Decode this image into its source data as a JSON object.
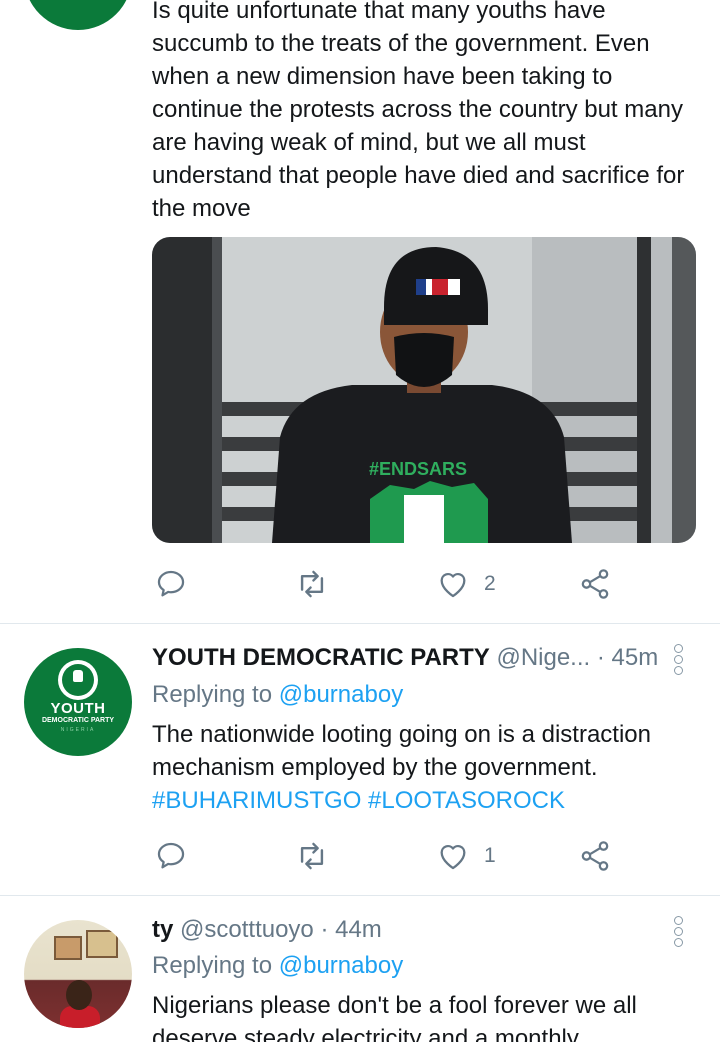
{
  "tweets": [
    {
      "text": "Is quite unfortunate that many youths have succumb to the treats of the government. Even when a new dimension have been taking to continue the protests across the country but many are having weak of mind, but we all must understand that people have died and sacrifice for the move",
      "media": {
        "shirt_text": "#ENDSARS"
      },
      "actions": {
        "reply_count": "",
        "retweet_count": "",
        "like_count": "2"
      }
    },
    {
      "display_name": "YOUTH DEMOCRATIC PARTY",
      "handle": "@Nige...",
      "time": "· 45m",
      "replying_prefix": "Replying to",
      "replying_to": "@burnaboy",
      "text": "The nationwide looting going on is a distraction mechanism employed by the government.",
      "hashtags": [
        "#BUHARIMUSTGO",
        "#LOOTASOROCK"
      ],
      "avatar": {
        "big": "YOUTH",
        "sub": "DEMOCRATIC PARTY",
        "country": "NIGERIA"
      },
      "actions": {
        "like_count": "1"
      }
    },
    {
      "display_name": "ty",
      "handle": "@scotttuoyo",
      "time": "· 44m",
      "replying_prefix": "Replying to",
      "replying_to": "@burnaboy",
      "text_line1": "Nigerians please don't be a fool forever we all",
      "text_line2": "deserve steady electricity and a monthly"
    }
  ],
  "icons": {
    "reply": "reply-icon",
    "retweet": "retweet-icon",
    "like": "heart-icon",
    "share": "share-icon",
    "more": "more-vertical-icon"
  },
  "colors": {
    "link": "#1da1f2",
    "muted": "#657786",
    "text": "#14171a",
    "divider": "#e1e8ed",
    "ydp_green": "#0b7a3a"
  }
}
